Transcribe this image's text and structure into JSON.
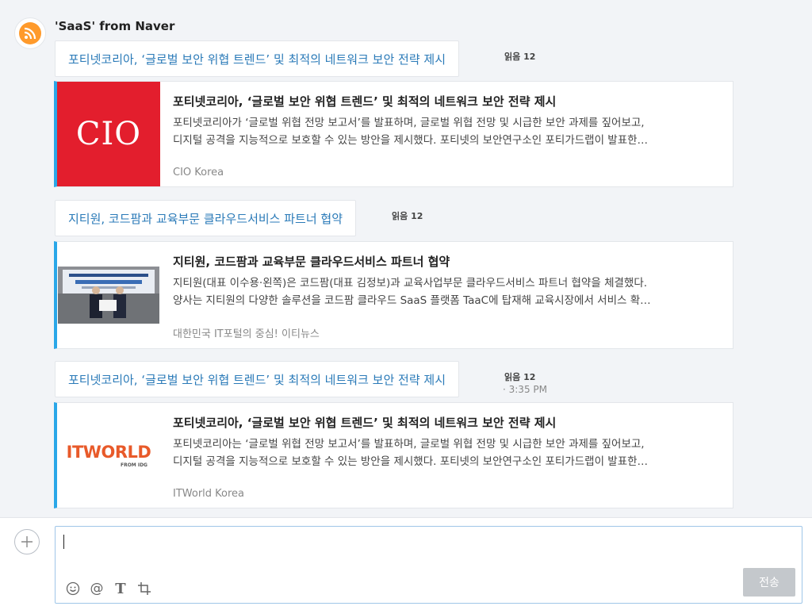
{
  "sender": {
    "name": "'SaaS' from Naver"
  },
  "messages": [
    {
      "bubble_text": "포티넷코리아, ‘글로벌 보안 위협 트렌드’ 및 최적의 네트워크 보안 전략 제시",
      "read_label": "읽음 12",
      "time": "",
      "card": {
        "title": "포티넷코리아, ‘글로벌 보안 위협 트렌드’ 및 최적의 네트워크 보안 전략 제시",
        "desc_line1": "포티넷코리아가 ‘글로벌 위협 전망 보고서’를 발표하며, 글로벌 위협 전망 및 시급한 보안 과제를 짚어보고,",
        "desc_line2": "디지털 공격을 지능적으로 보호할 수 있는 방안을 제시했다. 포티넷의 보안연구소인 포티가드랩이 발표한…",
        "source": "CIO Korea",
        "logo_text": "CIO"
      }
    },
    {
      "bubble_text": "지티원, 코드팜과 교육부문 클라우드서비스 파트너 협약",
      "read_label": "읽음 12",
      "time": "",
      "card": {
        "title": "지티원, 코드팜과 교육부문 클라우드서비스 파트너 협약",
        "desc_line1": "지티원(대표 이수용·왼쪽)은 코드팜(대표 김정보)과 교육사업부문 클라우드서비스 파트너 협약을 체결했다.",
        "desc_line2": "양사는 지티원의 다양한 솔루션을 코드팜 클라우드 SaaS 플랫폼 TaaC에 탑재해 교육시장에서 서비스 확…",
        "source": "대한민국 IT포털의 중심! 이티뉴스",
        "logo_text": ""
      }
    },
    {
      "bubble_text": "포티넷코리아, ‘글로벌 보안 위협 트렌드’ 및 최적의 네트워크 보안 전략 제시",
      "read_label": "읽음 12",
      "time": "· 3:35 PM",
      "card": {
        "title": "포티넷코리아, ‘글로벌 보안 위협 트렌드’ 및 최적의 네트워크 보안 전략 제시",
        "desc_line1": "포티넷코리아는 ‘글로벌 위협 전망 보고서’를 발표하며, 글로벌 위협 전망 및 시급한 보안 과제를 짚어보고,",
        "desc_line2": "디지털 공격을 지능적으로 보호할 수 있는 방안을 제시했다. 포티넷의 보안연구소인 포티가드랩이 발표한…",
        "source": "ITWorld Korea",
        "logo_text": "ITWORLD",
        "logo_sub": "FROM IDG"
      }
    }
  ],
  "composer": {
    "send_label": "전송",
    "tools": [
      "emoji-icon",
      "mention-icon",
      "text-format-icon",
      "crop-icon"
    ]
  },
  "colors": {
    "accent": "#2aa7e8",
    "link": "#2a7ab8",
    "cio_red": "#e31e2d",
    "itworld_orange": "#e85a2a",
    "rss_orange": "#ff9a2b"
  }
}
